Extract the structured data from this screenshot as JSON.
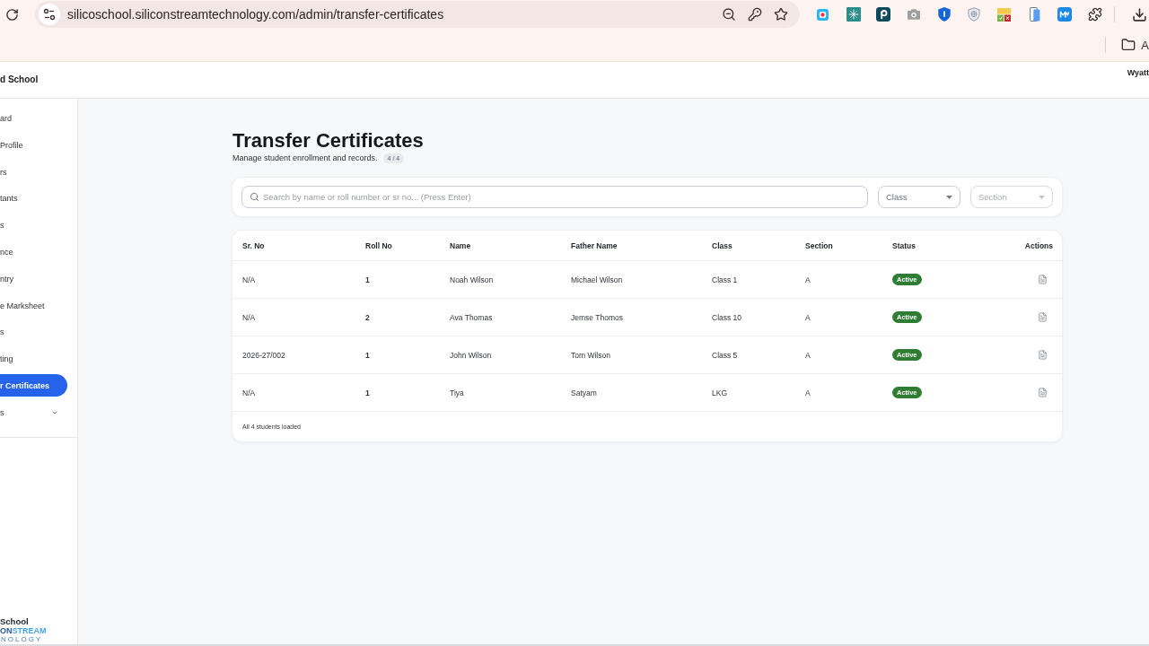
{
  "browser": {
    "url": "silicoschool.siliconstreamtechnology.com/admin/transfer-certificates",
    "bookmarks": [
      {
        "label": "A"
      }
    ]
  },
  "header": {
    "school_name": "d School",
    "user_name": "Wyatt"
  },
  "sidebar": {
    "items": [
      {
        "kind": "link",
        "label": "ard",
        "selected": false
      },
      {
        "kind": "link",
        "label": "Profile",
        "selected": false
      },
      {
        "kind": "link",
        "label": "rs",
        "selected": false
      },
      {
        "kind": "link",
        "label": "tants",
        "selected": false
      },
      {
        "kind": "link",
        "label": "s",
        "selected": false
      },
      {
        "kind": "link",
        "label": "nce",
        "selected": false
      },
      {
        "kind": "link",
        "label": "ntry",
        "selected": false
      },
      {
        "kind": "link",
        "label": "e Marksheet",
        "selected": false
      },
      {
        "kind": "link",
        "label": "s",
        "selected": false
      },
      {
        "kind": "link",
        "label": "ting",
        "selected": false
      },
      {
        "kind": "link",
        "label": "r Certificates",
        "selected": true
      },
      {
        "kind": "group",
        "label": "s",
        "selected": false,
        "expanded": false
      }
    ],
    "logo": {
      "name": "School",
      "wordmark": "ONSTREAM",
      "tagline": "NOLOGY"
    }
  },
  "page": {
    "title": "Transfer Certificates",
    "subtitle": "Manage student enrollment and records.",
    "count_badge": "4 / 4"
  },
  "filters": {
    "search": {
      "placeholder": "Search by name or roll number or sr no... (Press Enter)"
    },
    "selects": [
      {
        "placeholder": "Class",
        "disabled": false
      },
      {
        "placeholder": "Section",
        "disabled": true
      }
    ]
  },
  "table": {
    "columns": [
      "Sr. No",
      "Roll No",
      "Name",
      "Father Name",
      "Class",
      "Section",
      "Status",
      "Actions"
    ],
    "rows": [
      {
        "sr_no": "N/A",
        "roll_no": "1",
        "name": "Noah Wilson",
        "father_name": "Michael Wilson",
        "class": "Class 1",
        "section": "A",
        "status": "Active"
      },
      {
        "sr_no": "N/A",
        "roll_no": "2",
        "name": "Ava Thomas",
        "father_name": "Jemse Thomos",
        "class": "Class 10",
        "section": "A",
        "status": "Active"
      },
      {
        "sr_no": "2026-27/002",
        "roll_no": "1",
        "name": "John Wilson",
        "father_name": "Tom Wilson",
        "class": "Class 5",
        "section": "A",
        "status": "Active"
      },
      {
        "sr_no": "N/A",
        "roll_no": "1",
        "name": "Tiya",
        "father_name": "Satyam",
        "class": "LKG",
        "section": "A",
        "status": "Active"
      }
    ],
    "footer": "All 4 students loaded"
  }
}
